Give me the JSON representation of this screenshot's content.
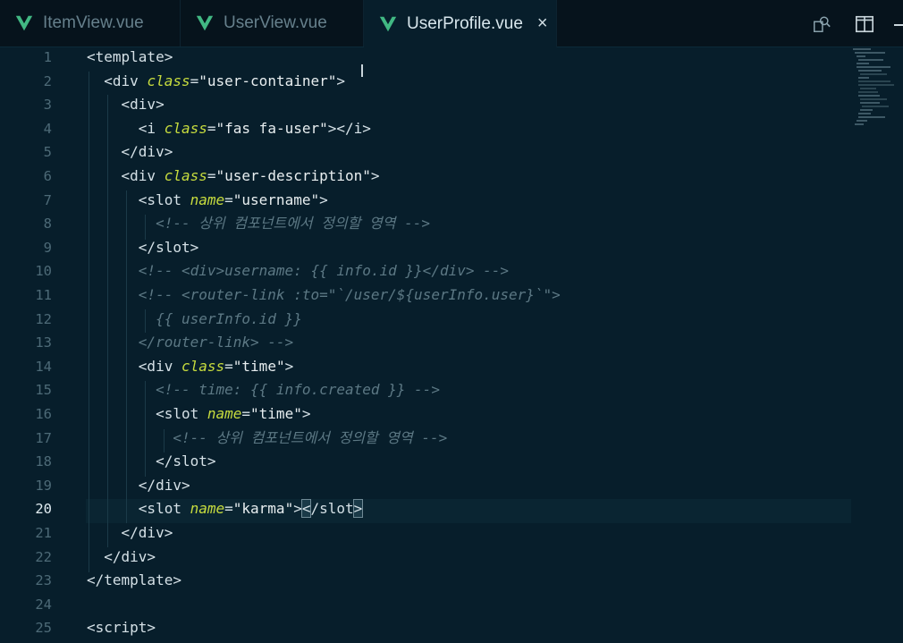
{
  "tabs": [
    {
      "label": "ItemView.vue",
      "active": false
    },
    {
      "label": "UserView.vue",
      "active": false
    },
    {
      "label": "UserProfile.vue",
      "active": true
    }
  ],
  "close_glyph": "×",
  "toolbar_icons": [
    "search-in-files-icon",
    "split-editor-icon"
  ],
  "colors": {
    "background": "#071e2b",
    "tag": "#d4e0e6",
    "attribute": "#c7dc3e",
    "comment": "#5c7884",
    "vue_logo": "#41b883"
  },
  "current_line": 20,
  "lines": [
    {
      "n": "1",
      "segs": [
        [
          "tag",
          "<template>"
        ]
      ]
    },
    {
      "n": "2",
      "segs": [
        [
          "tag",
          "  <div "
        ],
        [
          "attr",
          "class"
        ],
        [
          "tag",
          "="
        ],
        [
          "str",
          "\"user-container\""
        ],
        [
          "tag",
          ">"
        ]
      ]
    },
    {
      "n": "3",
      "segs": [
        [
          "tag",
          "    <div>"
        ]
      ]
    },
    {
      "n": "4",
      "segs": [
        [
          "tag",
          "      <i "
        ],
        [
          "attr",
          "class"
        ],
        [
          "tag",
          "="
        ],
        [
          "str",
          "\"fas fa-user\""
        ],
        [
          "tag",
          "></i>"
        ]
      ]
    },
    {
      "n": "5",
      "segs": [
        [
          "tag",
          "    </div>"
        ]
      ]
    },
    {
      "n": "6",
      "segs": [
        [
          "tag",
          "    <div "
        ],
        [
          "attr",
          "class"
        ],
        [
          "tag",
          "="
        ],
        [
          "str",
          "\"user-description\""
        ],
        [
          "tag",
          ">"
        ]
      ]
    },
    {
      "n": "7",
      "segs": [
        [
          "tag",
          "      <slot "
        ],
        [
          "attr",
          "name"
        ],
        [
          "tag",
          "="
        ],
        [
          "str",
          "\"username\""
        ],
        [
          "tag",
          ">"
        ]
      ]
    },
    {
      "n": "8",
      "segs": [
        [
          "cmt",
          "        <!-- 상위 컴포넌트에서 정의할 영역 -->"
        ]
      ]
    },
    {
      "n": "9",
      "segs": [
        [
          "tag",
          "      </slot>"
        ]
      ]
    },
    {
      "n": "10",
      "segs": [
        [
          "cmt",
          "      <!-- <div>username: {{ info.id }}</div> -->"
        ]
      ]
    },
    {
      "n": "11",
      "segs": [
        [
          "cmt",
          "      <!-- <router-link :to=\"`/user/${userInfo.user}`\">"
        ]
      ]
    },
    {
      "n": "12",
      "segs": [
        [
          "cmt",
          "        {{ userInfo.id }}"
        ]
      ]
    },
    {
      "n": "13",
      "segs": [
        [
          "cmt",
          "      </router-link> -->"
        ]
      ]
    },
    {
      "n": "14",
      "segs": [
        [
          "tag",
          "      <div "
        ],
        [
          "attr",
          "class"
        ],
        [
          "tag",
          "="
        ],
        [
          "str",
          "\"time\""
        ],
        [
          "tag",
          ">"
        ]
      ]
    },
    {
      "n": "15",
      "segs": [
        [
          "cmt",
          "        <!-- time: {{ info.created }} -->"
        ]
      ]
    },
    {
      "n": "16",
      "segs": [
        [
          "tag",
          "        <slot "
        ],
        [
          "attr",
          "name"
        ],
        [
          "tag",
          "="
        ],
        [
          "str",
          "\"time\""
        ],
        [
          "tag",
          ">"
        ]
      ]
    },
    {
      "n": "17",
      "segs": [
        [
          "cmt",
          "          <!-- 상위 컴포넌트에서 정의할 영역 -->"
        ]
      ]
    },
    {
      "n": "18",
      "segs": [
        [
          "tag",
          "        </slot>"
        ]
      ]
    },
    {
      "n": "19",
      "segs": [
        [
          "tag",
          "      </div>"
        ]
      ]
    },
    {
      "n": "20",
      "segs": [
        [
          "tag",
          "      <slot "
        ],
        [
          "attr",
          "name"
        ],
        [
          "tag",
          "="
        ],
        [
          "str",
          "\"karma\""
        ],
        [
          "tag",
          ">"
        ],
        [
          "hl",
          "<"
        ],
        [
          "tag",
          "/slot"
        ],
        [
          "hl",
          ">"
        ]
      ]
    },
    {
      "n": "21",
      "segs": [
        [
          "tag",
          "    </div>"
        ]
      ]
    },
    {
      "n": "22",
      "segs": [
        [
          "tag",
          "  </div>"
        ]
      ]
    },
    {
      "n": "23",
      "segs": [
        [
          "tag",
          "</template>"
        ]
      ]
    },
    {
      "n": "24",
      "segs": []
    },
    {
      "n": "25",
      "segs": [
        [
          "tag",
          "<script>"
        ]
      ]
    }
  ]
}
